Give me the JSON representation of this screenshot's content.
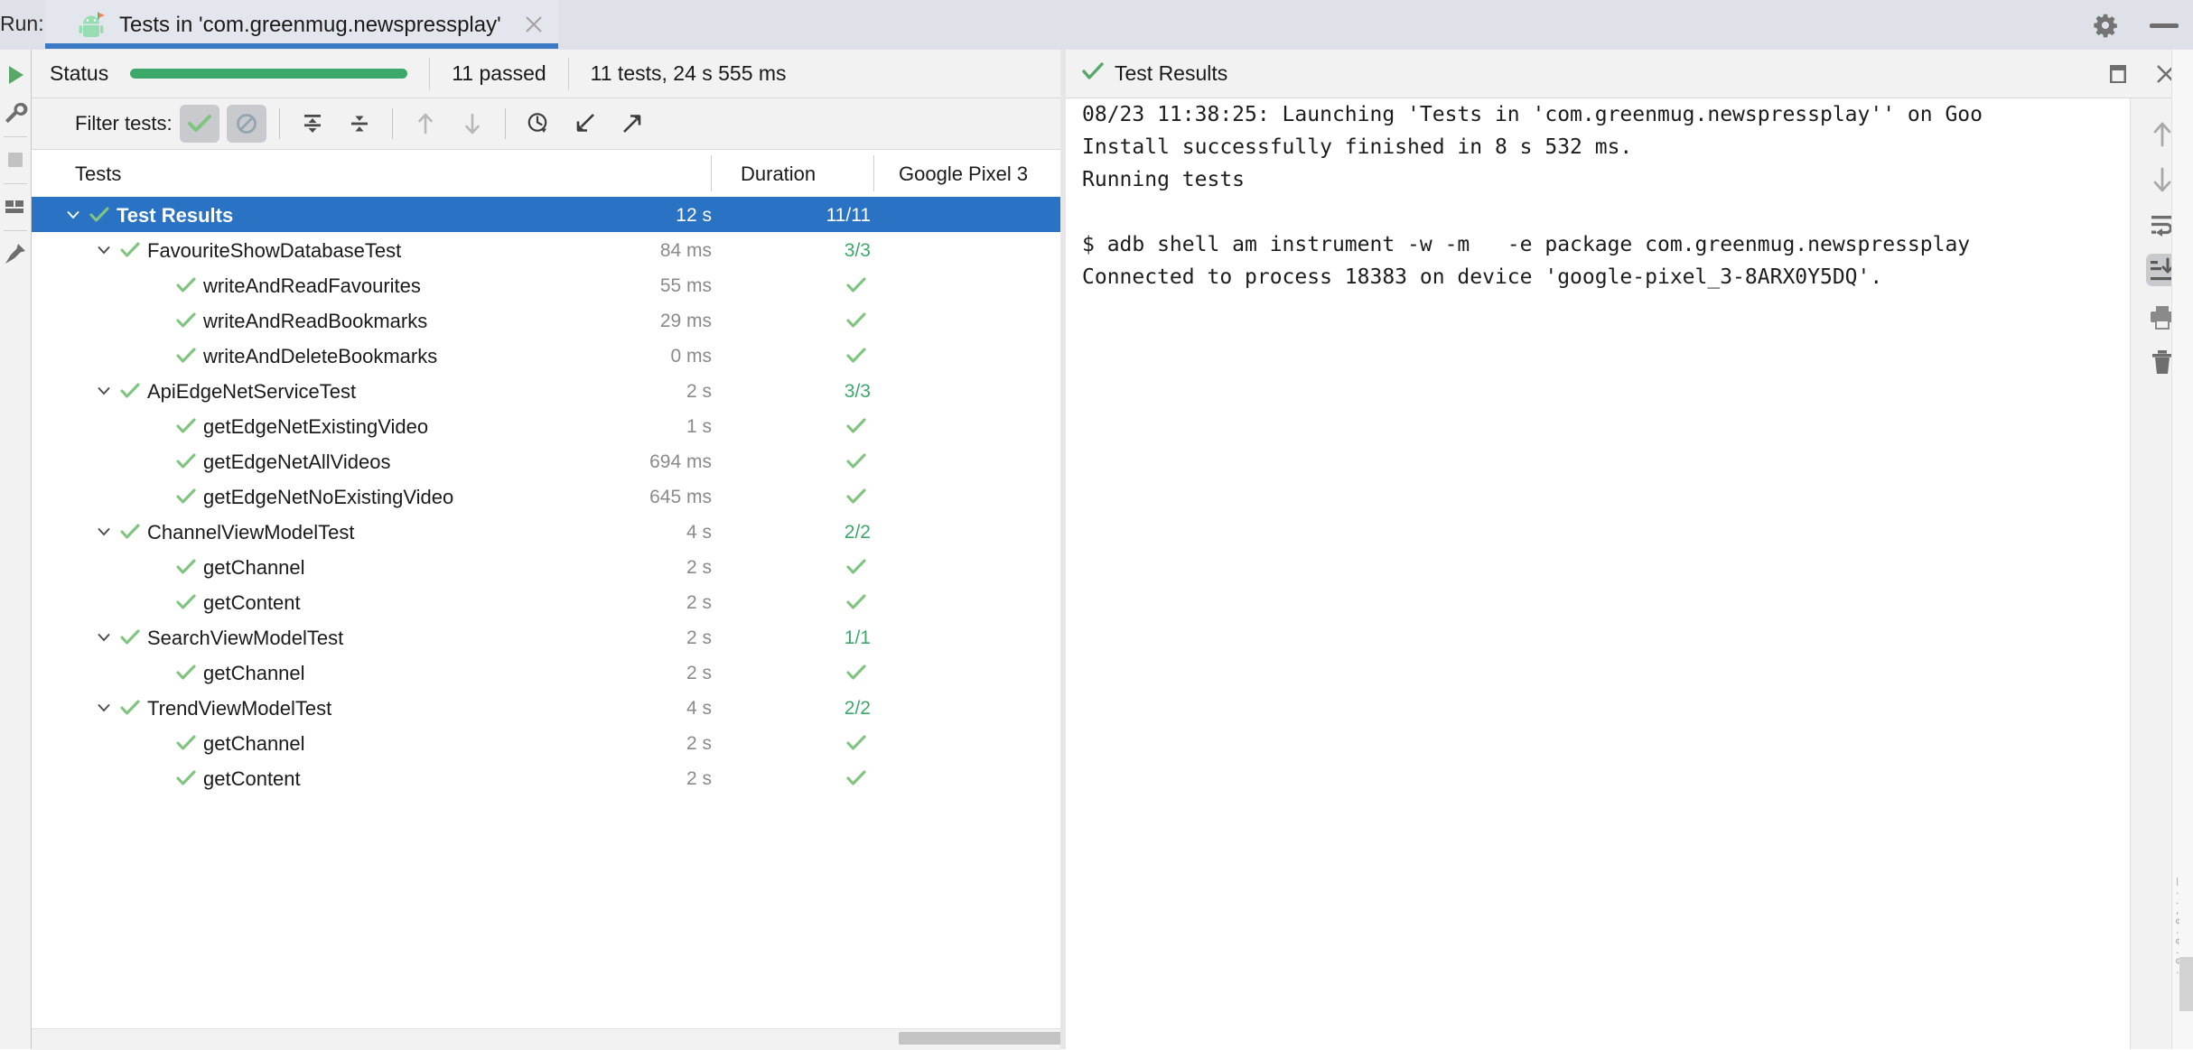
{
  "window": {
    "run_label": "Run:",
    "tab_title": "Tests in 'com.greenmug.newspressplay'",
    "gear_icon": "gear-icon",
    "minimize_icon": "minimize-icon",
    "close_tab_icon": "close-icon",
    "app_icon": "android-test-icon"
  },
  "left_gutter": {
    "items": [
      {
        "name": "rerun-tests-button",
        "icon": "play-icon"
      },
      {
        "name": "run-configuration-button",
        "icon": "wrench-icon"
      },
      {
        "name": "stop-button",
        "icon": "stop-square-icon"
      },
      {
        "name": "layout-settings-button",
        "icon": "layout-grid-icon"
      },
      {
        "name": "pin-tab-button",
        "icon": "pin-icon"
      }
    ]
  },
  "status": {
    "label": "Status",
    "progress_color": "#3ca86a",
    "progress_percent": 100,
    "passed": "11 passed",
    "summary": "11 tests, 24 s 555 ms"
  },
  "filter_bar": {
    "label": "Filter tests:",
    "buttons": [
      {
        "name": "show-passed-toggle",
        "icon": "green-check-icon",
        "active": true
      },
      {
        "name": "show-ignored-toggle",
        "icon": "ignored-circle-slash-icon",
        "active": true
      },
      {
        "name": "expand-all-button",
        "icon": "expand-all-icon",
        "active": false
      },
      {
        "name": "collapse-all-button",
        "icon": "collapse-all-icon",
        "active": false
      },
      {
        "name": "previous-failed-button",
        "icon": "arrow-up-icon",
        "active": false
      },
      {
        "name": "next-failed-button",
        "icon": "arrow-down-icon",
        "active": false
      },
      {
        "name": "sort-by-duration-button",
        "icon": "clock-dropdown-icon",
        "active": false
      },
      {
        "name": "import-tests-button",
        "icon": "import-arrow-icon",
        "active": false
      },
      {
        "name": "export-tests-button",
        "icon": "export-arrow-icon",
        "active": false
      }
    ]
  },
  "columns": {
    "tests": "Tests",
    "duration": "Duration",
    "device": "Google  Pixel 3"
  },
  "tree": [
    {
      "level": 0,
      "selected": true,
      "expandable": true,
      "name": "Test Results",
      "duration": "12 s",
      "device": "11/11",
      "device_is_tick": false,
      "status": "passed"
    },
    {
      "level": 1,
      "selected": false,
      "expandable": true,
      "name": "FavouriteShowDatabaseTest",
      "duration": "84 ms",
      "device": "3/3",
      "device_is_tick": false,
      "status": "passed"
    },
    {
      "level": 2,
      "selected": false,
      "expandable": false,
      "name": "writeAndReadFavourites",
      "duration": "55 ms",
      "device": "",
      "device_is_tick": true,
      "status": "passed"
    },
    {
      "level": 2,
      "selected": false,
      "expandable": false,
      "name": "writeAndReadBookmarks",
      "duration": "29 ms",
      "device": "",
      "device_is_tick": true,
      "status": "passed"
    },
    {
      "level": 2,
      "selected": false,
      "expandable": false,
      "name": "writeAndDeleteBookmarks",
      "duration": "0 ms",
      "device": "",
      "device_is_tick": true,
      "status": "passed"
    },
    {
      "level": 1,
      "selected": false,
      "expandable": true,
      "name": "ApiEdgeNetServiceTest",
      "duration": "2 s",
      "device": "3/3",
      "device_is_tick": false,
      "status": "passed"
    },
    {
      "level": 2,
      "selected": false,
      "expandable": false,
      "name": "getEdgeNetExistingVideo",
      "duration": "1 s",
      "device": "",
      "device_is_tick": true,
      "status": "passed"
    },
    {
      "level": 2,
      "selected": false,
      "expandable": false,
      "name": "getEdgeNetAllVideos",
      "duration": "694 ms",
      "device": "",
      "device_is_tick": true,
      "status": "passed"
    },
    {
      "level": 2,
      "selected": false,
      "expandable": false,
      "name": "getEdgeNetNoExistingVideo",
      "duration": "645 ms",
      "device": "",
      "device_is_tick": true,
      "status": "passed"
    },
    {
      "level": 1,
      "selected": false,
      "expandable": true,
      "name": "ChannelViewModelTest",
      "duration": "4 s",
      "device": "2/2",
      "device_is_tick": false,
      "status": "passed"
    },
    {
      "level": 2,
      "selected": false,
      "expandable": false,
      "name": "getChannel",
      "duration": "2 s",
      "device": "",
      "device_is_tick": true,
      "status": "passed"
    },
    {
      "level": 2,
      "selected": false,
      "expandable": false,
      "name": "getContent",
      "duration": "2 s",
      "device": "",
      "device_is_tick": true,
      "status": "passed"
    },
    {
      "level": 1,
      "selected": false,
      "expandable": true,
      "name": "SearchViewModelTest",
      "duration": "2 s",
      "device": "1/1",
      "device_is_tick": false,
      "status": "passed"
    },
    {
      "level": 2,
      "selected": false,
      "expandable": false,
      "name": "getChannel",
      "duration": "2 s",
      "device": "",
      "device_is_tick": true,
      "status": "passed"
    },
    {
      "level": 1,
      "selected": false,
      "expandable": true,
      "name": "TrendViewModelTest",
      "duration": "4 s",
      "device": "2/2",
      "device_is_tick": false,
      "status": "passed"
    },
    {
      "level": 2,
      "selected": false,
      "expandable": false,
      "name": "getChannel",
      "duration": "2 s",
      "device": "",
      "device_is_tick": true,
      "status": "passed"
    },
    {
      "level": 2,
      "selected": false,
      "expandable": false,
      "name": "getContent",
      "duration": "2 s",
      "device": "",
      "device_is_tick": true,
      "status": "passed"
    }
  ],
  "right_panel": {
    "title": "Test Results",
    "status_icon": "green-check-icon",
    "restore_icon": "restore-window-icon",
    "close_icon": "close-icon",
    "console_lines": [
      "08/23 11:38:25: Launching 'Tests in 'com.greenmug.newspressplay'' on Goo",
      "Install successfully finished in 8 s 532 ms.",
      "Running tests",
      "",
      "$ adb shell am instrument -w -m   -e package com.greenmug.newspressplay",
      "Connected to process 18383 on device 'google-pixel_3-8ARX0Y5DQ'."
    ],
    "tools": [
      {
        "name": "scroll-up-button",
        "icon": "arrow-up-icon",
        "active": false
      },
      {
        "name": "scroll-down-button",
        "icon": "arrow-down-icon",
        "active": false
      },
      {
        "name": "soft-wrap-button",
        "icon": "soft-wrap-icon",
        "active": false
      },
      {
        "name": "scroll-to-end-button",
        "icon": "scroll-to-end-icon",
        "active": true
      },
      {
        "name": "print-button",
        "icon": "printer-icon",
        "active": false
      },
      {
        "name": "clear-all-button",
        "icon": "trash-icon",
        "active": false
      }
    ]
  },
  "colors": {
    "accent": "#2a72c4",
    "pass_green": "#3ca86a",
    "tab_strip": "#dfe1e8",
    "panel_bg": "#f2f2f2"
  }
}
